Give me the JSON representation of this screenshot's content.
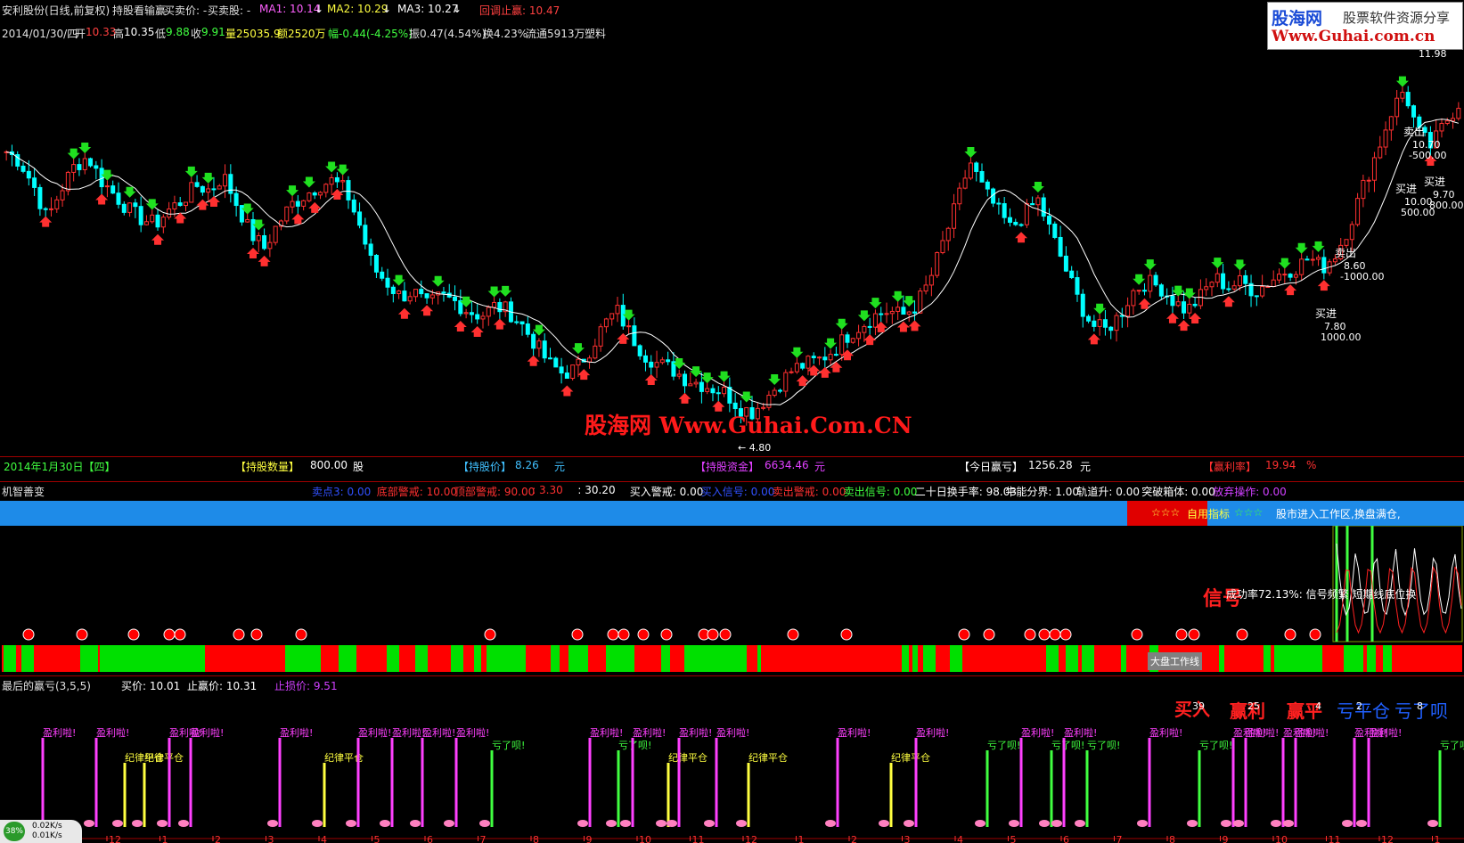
{
  "top": {
    "title": "安利股份(日线,前复权)",
    "indicator": "持股看输赢",
    "buysell_label": "买卖价: -",
    "buysell_stock_label": "买卖股: -",
    "ma1": "MA1: 10.14",
    "ma2": "MA2: 10.29",
    "ma3": "MA3: 10.27",
    "pullback": "回调止赢: 10.47",
    "arrow": "↓"
  },
  "info": {
    "date": "2014/01/30/四",
    "open_label": "开",
    "open": "10.33",
    "high_label": "高",
    "high": "10.35",
    "low_label": "低",
    "low": "9.88",
    "close_label": "收",
    "close": "9.91",
    "vol": "量25035.9",
    "amount": "额2520万",
    "change": "幅-0.44(-4.25%)",
    "amp": "振0.47(4.54%)",
    "turnover": "换4.23%",
    "float": "流通5913万",
    "industry": "塑料"
  },
  "logo": {
    "line1a": "股海网",
    "line1b": "股票软件资源分享",
    "line2": "Www.Guhai.com.cn"
  },
  "watermark": "股海网 Www.Guhai.Com.CN",
  "main_annotations": {
    "high_price": "11.98",
    "low_price": "← 4.80",
    "trades": [
      {
        "label": "卖出",
        "price": "10.70",
        "amount": "-500.00"
      },
      {
        "label": "买进",
        "price": "9.70",
        "amount": "800.00"
      },
      {
        "label": "买进",
        "price": "10.00",
        "amount": "500.00"
      },
      {
        "label": "卖出",
        "price": "8.60",
        "amount": "-1000.00"
      },
      {
        "label": "买进",
        "price": "7.80",
        "amount": "1000.00"
      }
    ]
  },
  "status": {
    "date": "2014年1月30日【四】",
    "qty_label": "【持股数量】",
    "qty": "800.00",
    "qty_unit": "股",
    "price_label": "【持股价】",
    "price": "8.26",
    "price_unit": "元",
    "fund_label": "【持股资金】",
    "fund": "6634.46",
    "fund_unit": "元",
    "pnl_label": "【今日赢亏】",
    "pnl": "1256.28",
    "pnl_unit": "元",
    "rate_label": "【赢利率】",
    "rate": "19.94",
    "rate_unit": "%"
  },
  "jizhi": {
    "name": "机智善变",
    "items": [
      {
        "text": "卖点3: 0.00",
        "color": "#3050ff"
      },
      {
        "text": "底部警戒: 10.00",
        "color": "#ff3030"
      },
      {
        "text": "顶部警戒: 90.00",
        "color": "#ff3030"
      },
      {
        "text": ": 3.30",
        "color": "#ff3030"
      },
      {
        "text": ": 30.20",
        "color": "#ffffff"
      },
      {
        "text": "买入警戒: 0.00",
        "color": "#ffffff"
      },
      {
        "text": "买入信号: 0.00",
        "color": "#3050ff"
      },
      {
        "text": "卖出警戒: 0.00",
        "color": "#ff3030"
      },
      {
        "text": "卖出信号: 0.00",
        "color": "#40ff40"
      },
      {
        "text": "二十日换手率: 98.03",
        "color": "#ffffff"
      },
      {
        "text": "牛能分界: 1.00",
        "color": "#ffffff"
      },
      {
        "text": "轨道升: 0.00",
        "color": "#ffffff"
      },
      {
        "text": "突破箱体: 0.00",
        "color": "#ffffff"
      },
      {
        "text": "放弃操作: 0.00",
        "color": "#d040ff"
      }
    ]
  },
  "bluebar": {
    "stars1": "☆☆☆",
    "self_label": "自用指标",
    "stars2": "☆☆☆",
    "msg": "股市进入工作区,换盘满仓,"
  },
  "panel2": {
    "signal": "信号",
    "success": "成功率72.13%: 信号频繁 短期线底位换",
    "market_line": "大盘工作线"
  },
  "bottom": {
    "title": "最后的赢亏(3,5,5)",
    "buy_price": "买价: 10.01",
    "stop_win": "止赢价: 10.31",
    "stop_loss": "止损价: 9.51"
  },
  "panel3": {
    "legend_buy": "买入",
    "legend_win": "赢利",
    "legend_even": "赢平",
    "legend_loss": "亏平仓",
    "legend_lost": "亏了呗",
    "n1": "39",
    "n2": "25",
    "n3": "4",
    "n4": "2",
    "n5": "8",
    "win_label": "盈利啦!",
    "loss_label": "亏了呗!",
    "disc_label": "纪律平仓",
    "axis_months": [
      "12",
      "1",
      "2",
      "3",
      "4",
      "5",
      "6",
      "7",
      "8",
      "9",
      "10",
      "11",
      "12",
      "1",
      "2",
      "3",
      "4",
      "5",
      "6",
      "7",
      "8",
      "9",
      "10",
      "11",
      "12",
      "1"
    ]
  },
  "net": {
    "pct": "38%",
    "up": "0.02K/s",
    "down": "0.01K/s"
  },
  "colors": {
    "up": "#ff3030",
    "down": "#00ffff",
    "buy_arrow": "#ff3030",
    "sell_arrow": "#20e020",
    "bar_red": "#ff0000",
    "bar_green": "#00e000",
    "blue": "#1e8be8"
  },
  "chart_data": {
    "type": "candlestick",
    "ylim": [
      4.5,
      12.3
    ],
    "price_path": [
      10.3,
      10.1,
      9.6,
      8.9,
      9.5,
      10.0,
      10.2,
      9.7,
      9.4,
      9.1,
      8.9,
      8.8,
      9.1,
      9.3,
      9.6,
      9.5,
      9.8,
      9.2,
      8.6,
      8.3,
      8.8,
      9.2,
      9.4,
      9.6,
      9.7,
      9.5,
      8.8,
      7.9,
      7.6,
      7.3,
      7.4,
      7.1,
      7.3,
      7.2,
      7.0,
      6.9,
      7.1,
      7.0,
      6.7,
      6.3,
      5.9,
      5.7,
      5.8,
      6.2,
      6.7,
      7.0,
      6.5,
      6.1,
      5.9,
      5.8,
      5.6,
      5.5,
      5.4,
      5.3,
      5.0,
      4.9,
      5.2,
      5.5,
      5.8,
      5.9,
      6.0,
      6.2,
      6.5,
      6.7,
      6.9,
      7.0,
      6.9,
      7.1,
      7.6,
      8.4,
      9.2,
      10.1,
      9.5,
      9.1,
      8.7,
      9.0,
      9.3,
      8.6,
      7.9,
      7.2,
      6.7,
      6.6,
      6.9,
      7.4,
      7.6,
      7.5,
      7.2,
      7.0,
      7.3,
      7.7,
      7.5,
      7.6,
      7.4,
      7.6,
      7.8,
      7.9,
      8.1,
      7.9,
      8.2,
      8.8,
      9.6,
      10.3,
      11.1,
      11.6,
      10.7,
      10.4,
      10.9,
      11.3
    ]
  }
}
